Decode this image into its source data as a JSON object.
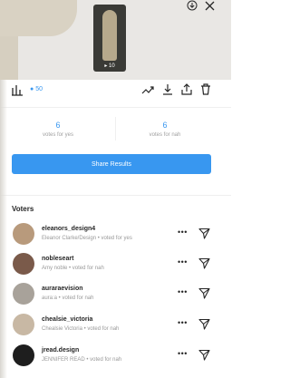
{
  "story": {
    "thumbnail_view_count": "▸ 10",
    "view_count": "50"
  },
  "poll": {
    "left_count": "6",
    "left_label": "votes for yes",
    "right_count": "6",
    "right_label": "votes for nah"
  },
  "share_button_label": "Share Results",
  "voters_title": "Voters",
  "voters": [
    {
      "username": "eleanors_design4",
      "subtitle": "Eleanor Clarke/Design • voted for yes",
      "avatar_color": "#b89a7c"
    },
    {
      "username": "nobleseart",
      "subtitle": "Amy noble • voted for nah",
      "avatar_color": "#7a5a4a"
    },
    {
      "username": "auraraevision",
      "subtitle": "aura:a • voted for nah",
      "avatar_color": "#a8a29a"
    },
    {
      "username": "chealsie_victoria",
      "subtitle": "Chealsie Victoria • voted for nah",
      "avatar_color": "#c8b8a4"
    },
    {
      "username": "jread.design",
      "subtitle": "JENNIFER READ • voted for nah",
      "avatar_color": "#1e1e1e"
    }
  ],
  "colors": {
    "accent": "#3897f0",
    "text": "#262626",
    "muted": "#999999"
  },
  "icons": [
    "download-story-icon",
    "close-icon",
    "stats-icon",
    "trend-icon",
    "download-icon",
    "share-icon",
    "delete-icon",
    "more-icon",
    "send-icon"
  ]
}
